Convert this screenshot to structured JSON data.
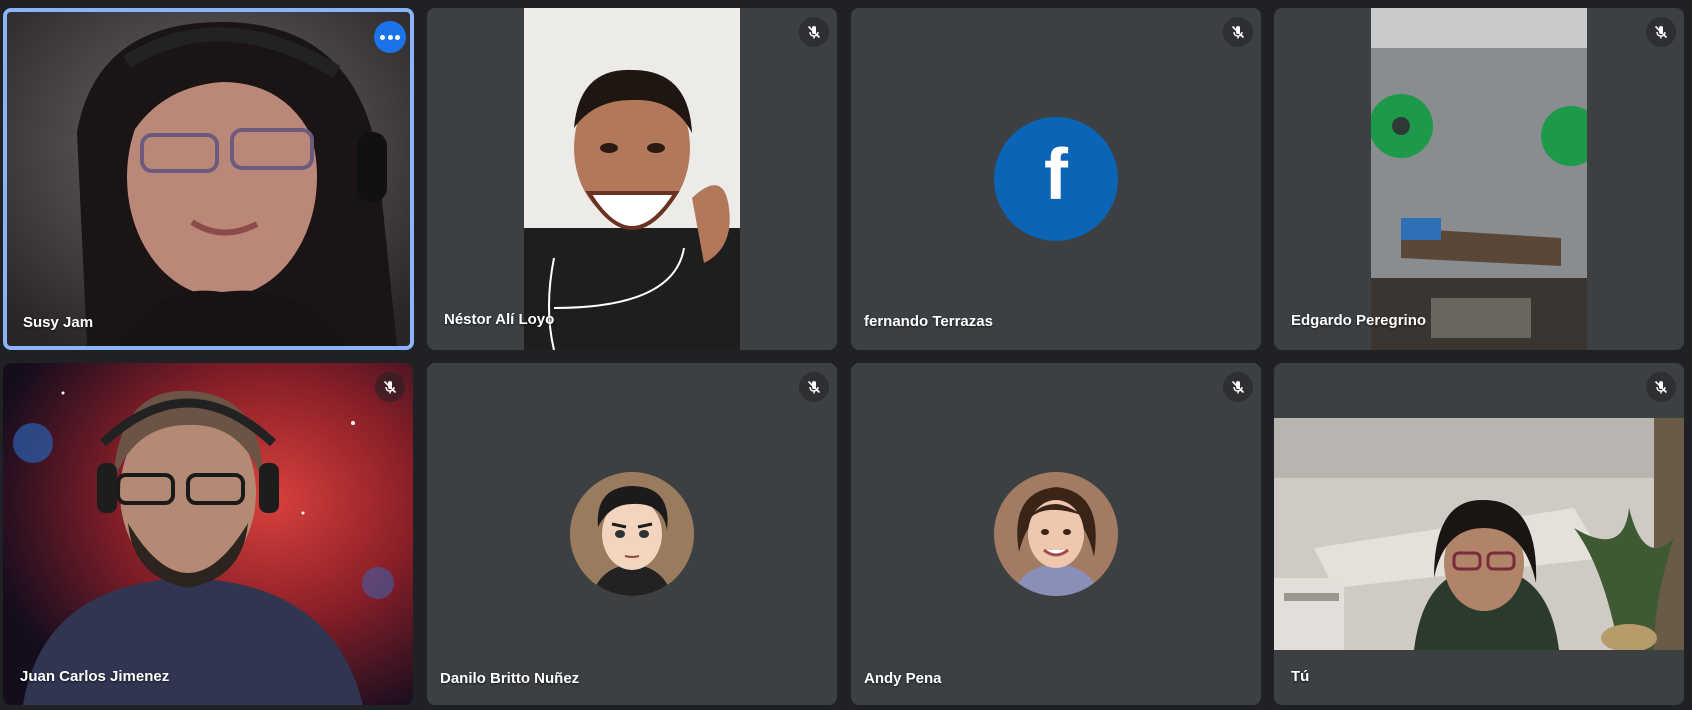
{
  "participants": [
    {
      "name": "Susy Jam",
      "speaking": true
    },
    {
      "name": "Néstor Alí Loyo",
      "muted": true
    },
    {
      "name": "fernando Terrazas",
      "muted": true,
      "avatar_letter": "f",
      "avatar_color": "#0c64b6"
    },
    {
      "name": "Edgardo Peregrino",
      "muted": true
    },
    {
      "name": "Juan Carlos Jimenez",
      "muted": true
    },
    {
      "name": "Danilo Britto Nuñez",
      "muted": true
    },
    {
      "name": "Andy Pena",
      "muted": true
    },
    {
      "name": "Tú",
      "muted": true
    }
  ],
  "icons": {
    "mute": "mic-off-icon",
    "more": "more-options-icon"
  },
  "colors": {
    "background": "#202124",
    "tile": "#3c4043",
    "active_border": "#8ab4f8",
    "more_button": "#1a73e8"
  }
}
